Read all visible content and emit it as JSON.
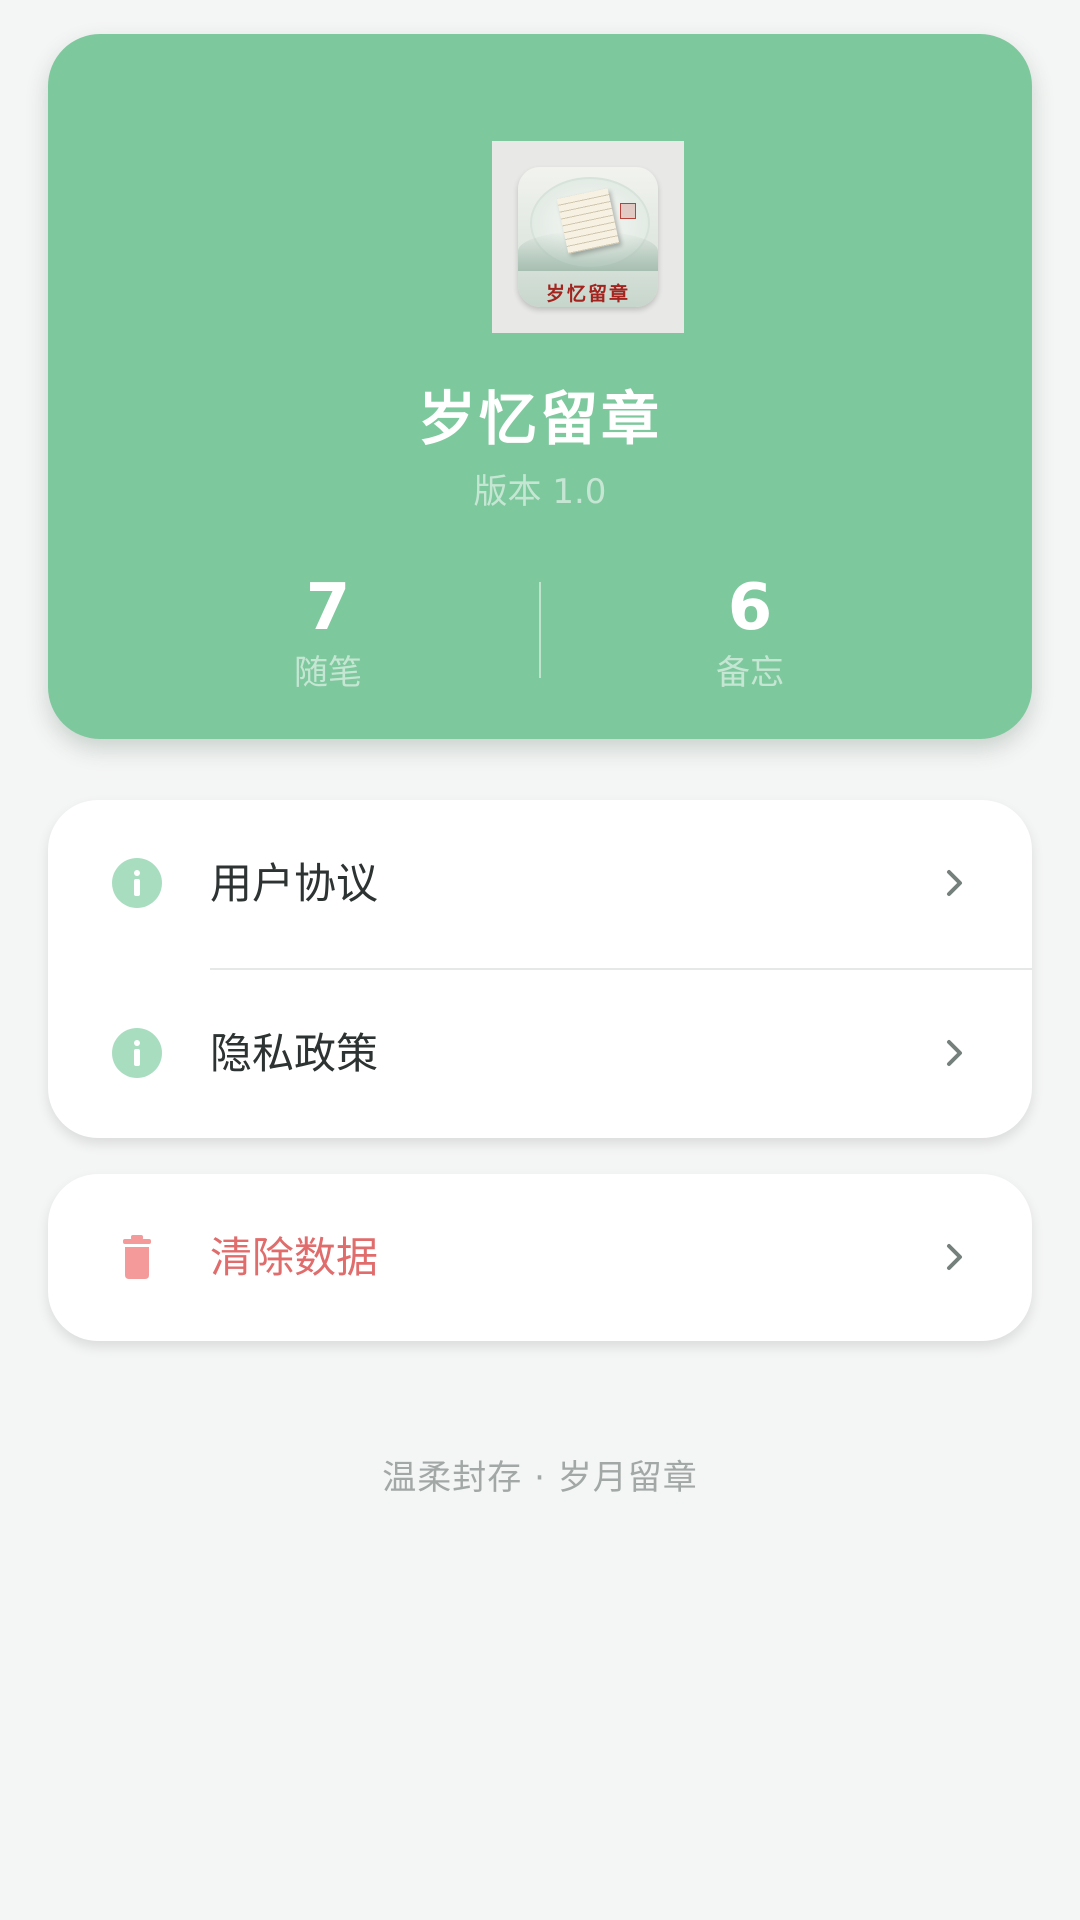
{
  "colors": {
    "accent": "#7ec89d",
    "info_icon": "#a9ddc0",
    "danger": "#e06c6c",
    "danger_icon": "#f59a9a",
    "background": "#f4f5f5"
  },
  "header": {
    "logo_icon": "app-logo",
    "logo_text": "岁忆留章",
    "app_name": "岁忆留章",
    "version": "版本 1.0",
    "stats": [
      {
        "value": "7",
        "label": "随笔"
      },
      {
        "value": "6",
        "label": "备忘"
      }
    ]
  },
  "menu": {
    "items": [
      {
        "label": "用户协议",
        "icon": "info-icon"
      },
      {
        "label": "隐私政策",
        "icon": "info-icon"
      }
    ]
  },
  "danger": {
    "label": "清除数据",
    "icon": "trash-icon"
  },
  "footer": {
    "tagline": "温柔封存 · 岁月留章"
  }
}
